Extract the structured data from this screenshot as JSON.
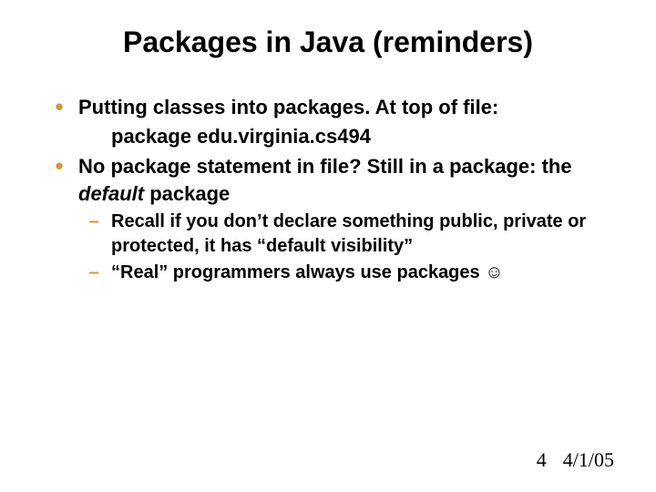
{
  "title": "Packages in Java (reminders)",
  "bullets": {
    "b1": "Putting classes into packages. At top of file:",
    "b1_cont": "package edu.virginia.cs494",
    "b2_pre": "No package statement in file?  Still in a package:  the ",
    "b2_em": "default",
    "b2_post": " package",
    "s1": "Recall if you don’t declare something public, private or protected, it has “default visibility”",
    "s2": "“Real” programmers always use packages ☺"
  },
  "footer": {
    "page": "4",
    "date": "4/1/05"
  }
}
